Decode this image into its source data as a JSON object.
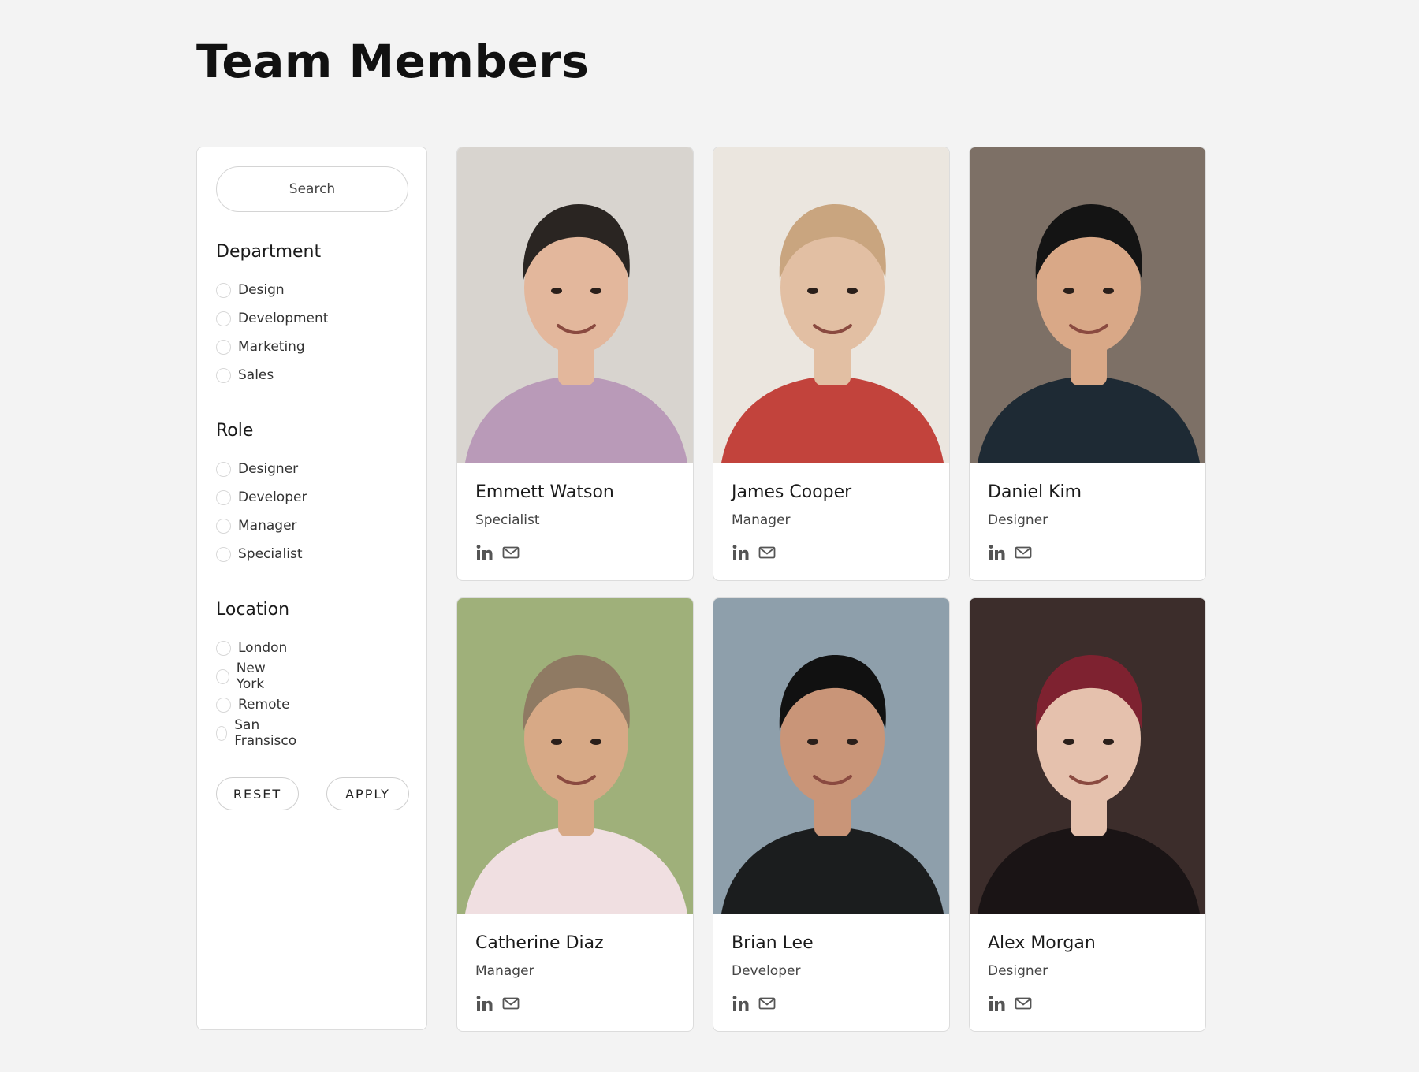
{
  "page": {
    "title": "Team Members"
  },
  "filters": {
    "search_placeholder": "Search",
    "groups": [
      {
        "title": "Department",
        "options": [
          "Design",
          "Development",
          "Marketing",
          "Sales"
        ]
      },
      {
        "title": "Role",
        "options": [
          "Designer",
          "Developer",
          "Manager",
          "Specialist"
        ]
      },
      {
        "title": "Location",
        "options": [
          "London",
          "New York",
          "Remote",
          "San Fransisco"
        ]
      }
    ],
    "reset_label": "RESET",
    "apply_label": "APPLY"
  },
  "members": [
    {
      "name": "Emmett Watson",
      "role": "Specialist",
      "photo": {
        "bg": "#d8d4cf",
        "skin": "#e3b79c",
        "hair": "#2a2522",
        "shirt": "#b99ab8"
      }
    },
    {
      "name": "James Cooper",
      "role": "Manager",
      "photo": {
        "bg": "#ebe6df",
        "skin": "#e2bfa3",
        "hair": "#c9a57f",
        "shirt": "#c2433c"
      }
    },
    {
      "name": "Daniel Kim",
      "role": "Designer",
      "photo": {
        "bg": "#7d7066",
        "skin": "#d9a887",
        "hair": "#141414",
        "shirt": "#1e2a34"
      }
    },
    {
      "name": "Catherine Diaz",
      "role": "Manager",
      "photo": {
        "bg": "#9fb07a",
        "skin": "#d7a986",
        "hair": "#8f7a63",
        "shirt": "#f0dfe1"
      }
    },
    {
      "name": "Brian Lee",
      "role": "Developer",
      "photo": {
        "bg": "#8e9fab",
        "skin": "#c99578",
        "hair": "#111111",
        "shirt": "#1b1d1e"
      }
    },
    {
      "name": "Alex Morgan",
      "role": "Designer",
      "photo": {
        "bg": "#3c2d2b",
        "skin": "#e5c1ad",
        "hair": "#7e2230",
        "shirt": "#1a1415"
      }
    }
  ],
  "icons": {
    "linkedin": "linkedin-icon",
    "email": "mail-icon"
  },
  "colors": {
    "background": "#f3f3f3",
    "card": "#ffffff",
    "icon": "#555555"
  }
}
